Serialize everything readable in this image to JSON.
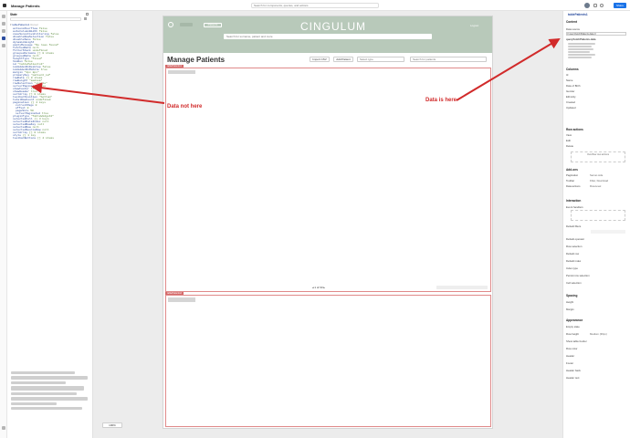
{
  "app": {
    "title": "Manage Patients",
    "search_placeholder": "Search for components, queries, and actions",
    "share_label": "Share"
  },
  "state_panel": {
    "header": "State",
    "selected_query": "tablePatients1",
    "selected_query_note": "Retool",
    "lines": [
      {
        "k": "actionsOverflow",
        "v": "false"
      },
      {
        "k": "autoColumnWidth",
        "v": "false"
      },
      {
        "k": "caseSensitiveFiltering",
        "v": "false"
      },
      {
        "k": "disableRowSelection",
        "v": "false"
      },
      {
        "k": "disableSave",
        "v": "false"
      },
      {
        "k": "dynamicHeight",
        "v": ""
      },
      {
        "k": "emptyMessage",
        "v": "\"No rows found\""
      },
      {
        "k": "fetchedData",
        "v": "null"
      },
      {
        "k": "filterStack",
        "v": "undefined"
      },
      {
        "k": "groupedColumns",
        "v": "[] 0 items"
      },
      {
        "k": "groupedData",
        "v": "null"
      },
      {
        "k": "heightType",
        "v": "\"fixed\""
      },
      {
        "k": "hidden",
        "v": "false"
      },
      {
        "k": "id",
        "v": "\"tablePatients1\""
      },
      {
        "k": "isHiddenOnDesktop",
        "v": "false"
      },
      {
        "k": "isHiddenOnMobile",
        "v": "true"
      },
      {
        "k": "margin",
        "v": "\"4px 8px\""
      },
      {
        "k": "primaryKey",
        "v": "\"patient_id\""
      },
      {
        "k": "rowData",
        "v": "[] 0 items"
      },
      {
        "k": "rowHeight",
        "v": "\"medium\""
      },
      {
        "k": "rowSelection",
        "v": "\"single\""
      },
      {
        "k": "serverPaginated",
        "v": "true"
      },
      {
        "k": "showFooter",
        "v": "true"
      },
      {
        "k": "showHeader",
        "v": "true"
      },
      {
        "k": "sortArray",
        "v": "[] 0 items"
      },
      {
        "k": "toolbarPosition",
        "v": "\"bottom\""
      },
      {
        "k": "totalRowCount",
        "v": "undefined"
      },
      {
        "k": "pagination",
        "v": "{} 4 keys"
      },
      {
        "k": "currentPage",
        "v": "0"
      },
      {
        "k": "offset",
        "v": "0"
      },
      {
        "k": "pageSize",
        "v": "50"
      },
      {
        "k": "serverPaginated",
        "v": "true"
      },
      {
        "k": "pluginType",
        "v": "\"TableWidget2\""
      },
      {
        "k": "selectedCell",
        "v": "{} 3 keys"
      },
      {
        "k": "selectedDataIndex",
        "v": "null"
      },
      {
        "k": "selectedRowKey",
        "v": "null"
      },
      {
        "k": "selectedRow",
        "v": "null"
      },
      {
        "k": "selectedSourceRow",
        "v": "null"
      },
      {
        "k": "sortArray",
        "v": "[] 0 items"
      },
      {
        "k": "style",
        "v": "{} 1 key"
      },
      {
        "k": "toolbarButtons",
        "v": "[] 4 items"
      }
    ]
  },
  "app_frame": {
    "brand": "CINGULUM",
    "nav_item": "Patients",
    "nav_right": "Logout",
    "search_placeholder": "Search for surname, patient and more",
    "page_title": "Manage Patients",
    "import_label": "Import CSV",
    "add_label": "Add Patient",
    "select_placeholder": "Select type",
    "search_patients_placeholder": "Search for patients",
    "table_tag": "tablePatients1",
    "pagination": "1 of 33",
    "bottom_tag": "tablePatients2",
    "zoom": "100%"
  },
  "annotations": {
    "left": "Data not here",
    "right": "Data is here"
  },
  "inspector": {
    "title": "tablePatients1",
    "content_header": "Content",
    "data_source_label": "Data source",
    "data_source_value": "{{ queryFetchPatients.data }}",
    "query_value": "queryFetchPatients.data",
    "columns_header": "Columns",
    "columns": [
      "Id",
      "Name",
      "Date of Birth",
      "Gender",
      "Ethnicity",
      "Created",
      "Updated"
    ],
    "row_actions_header": "Row actions",
    "row_actions": [
      "View",
      "Edit",
      "Delete"
    ],
    "overflow_label": "Overflow row actions",
    "add_ons_header": "Add-ons",
    "add_ons": [
      {
        "k": "Pagination",
        "v": "Server-side"
      },
      {
        "k": "Toolbar",
        "v": "Filter, Download"
      },
      {
        "k": "Data actions",
        "v": "Row-level"
      }
    ],
    "interaction_header": "Interaction",
    "event_handlers_header": "Event handlers",
    "default_filters_header": "Default filters",
    "default_operator": "Default operator",
    "row_selection": "Row selection",
    "default_row": "Default row",
    "default_index": "Default index",
    "index_type": "Index type",
    "persist_label": "Persist row selection",
    "cell_selection": "Cell selection",
    "spacing_header": "Spacing",
    "height_label": "Height",
    "margin_label": "Margin",
    "appearance_header": "Appearance",
    "empty_state": "Empty state",
    "row_height": "Row height",
    "row_height_value": "Medium (36px)",
    "show_border": "Show table border",
    "row_color": "Row color",
    "header_label": "Header",
    "footer_label": "Footer",
    "header_bg": "Header back",
    "header_text": "Header text"
  },
  "colors": {
    "accent": "#1a73e8",
    "annotation": "#d12a2a",
    "header_bg": "#b8c9ba",
    "table_border": "#e08a8a"
  }
}
